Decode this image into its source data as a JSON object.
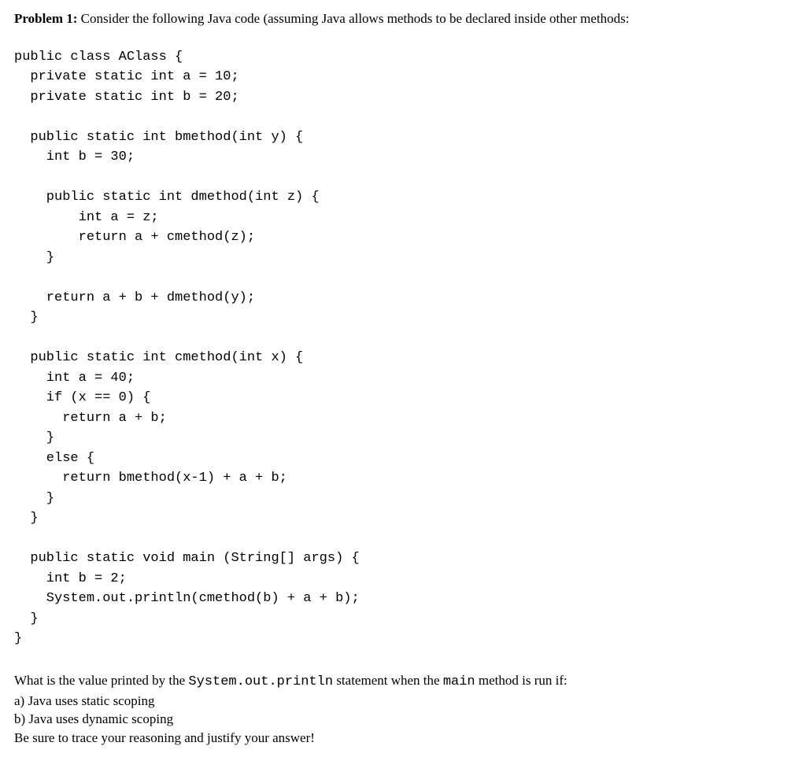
{
  "header": {
    "label": "Problem 1:",
    "text": " Consider the following Java code (assuming Java allows methods to be declared inside other methods:"
  },
  "code": "public class AClass {\n  private static int a = 10;\n  private static int b = 20;\n\n  public static int bmethod(int y) {\n    int b = 30;\n\n    public static int dmethod(int z) {\n        int a = z;\n        return a + cmethod(z);\n    }\n\n    return a + b + dmethod(y);\n  }\n\n  public static int cmethod(int x) {\n    int a = 40;\n    if (x == 0) {\n      return a + b;\n    }\n    else {\n      return bmethod(x-1) + a + b;\n    }\n  }\n\n  public static void main (String[] args) {\n    int b = 2;\n    System.out.println(cmethod(b) + a + b);\n  }\n}",
  "question": {
    "intro_prefix": "What is the value printed by the ",
    "code1": "System.out.println",
    "intro_mid": " statement when the ",
    "code2": "main",
    "intro_suffix": " method is run if:",
    "part_a": "a) Java uses static scoping",
    "part_b": "b) Java uses dynamic scoping",
    "closing": "Be sure to trace your reasoning and justify your answer!"
  }
}
